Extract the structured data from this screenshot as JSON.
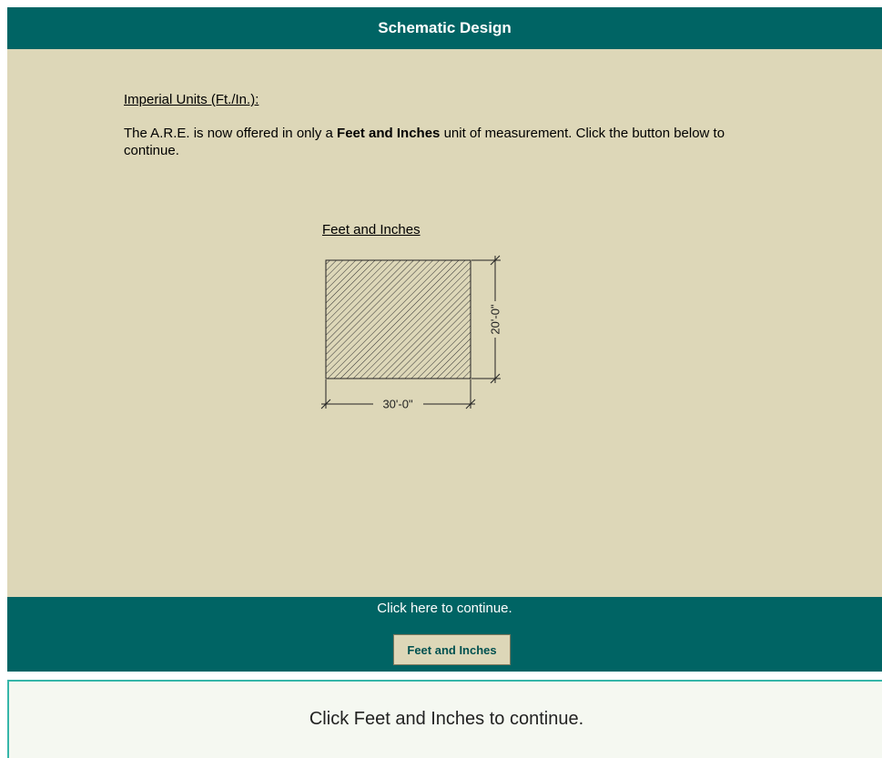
{
  "header": {
    "title": "Schematic Design"
  },
  "main": {
    "section_heading": "Imperial Units (Ft./In.):",
    "intro_pre": "The A.R.E. is now offered in only a ",
    "intro_bold": "Feet and Inches",
    "intro_post": " unit of measurement. Click the button below to continue.",
    "diagram": {
      "title": "Feet and Inches",
      "width_label": "30'-0\"",
      "height_label": "20'-0\""
    }
  },
  "footer": {
    "continue_text": "Click here to continue.",
    "button_label": "Feet and Inches"
  },
  "instruction": {
    "text": "Click Feet and Inches to continue."
  },
  "colors": {
    "header_bg": "#006464",
    "content_bg": "#ddd7b8",
    "instruction_border": "#36b6a9"
  }
}
